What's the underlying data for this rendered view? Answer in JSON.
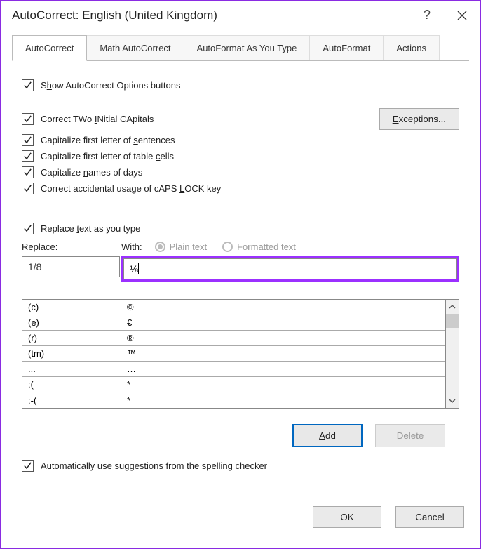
{
  "title": "AutoCorrect: English (United Kingdom)",
  "tabs": [
    "AutoCorrect",
    "Math AutoCorrect",
    "AutoFormat As You Type",
    "AutoFormat",
    "Actions"
  ],
  "active_tab": 0,
  "checks": {
    "show_options": {
      "pre": "S",
      "u": "h",
      "post": "ow AutoCorrect Options buttons"
    },
    "two_initial": {
      "pre": "Correct TWo ",
      "u": "I",
      "post": "Nitial CApitals"
    },
    "sentences": {
      "pre": "Capitalize first letter of ",
      "u": "s",
      "post": "entences"
    },
    "table_cells": {
      "pre": "Capitalize first letter of table ",
      "u": "c",
      "post": "ells"
    },
    "days": {
      "pre": "Capitalize ",
      "u": "n",
      "post": "ames of days"
    },
    "caps_lock": {
      "pre": "Correct accidental usage of cAPS ",
      "u": "L",
      "post": "OCK key"
    },
    "replace_as_type": {
      "pre": "Replace ",
      "u": "t",
      "post": "ext as you type"
    },
    "auto_suggest": {
      "pre": "Automatically use su",
      "u": "g",
      "post": "gestions from the spelling checker"
    }
  },
  "exceptions_btn": {
    "u": "E",
    "post": "xceptions..."
  },
  "replace_label": {
    "u": "R",
    "post": "eplace:"
  },
  "with_label": {
    "u": "W",
    "post": "ith:"
  },
  "radio_plain": "Plain text",
  "radio_formatted": "Formatted text",
  "replace_value": "1/8",
  "with_value": "⅛",
  "table": [
    {
      "a": "(c)",
      "b": "©"
    },
    {
      "a": "(e)",
      "b": "€"
    },
    {
      "a": "(r)",
      "b": "®"
    },
    {
      "a": "(tm)",
      "b": "™"
    },
    {
      "a": "...",
      "b": "…"
    },
    {
      "a": ":(",
      "b": "*"
    },
    {
      "a": ":-(",
      "b": "*"
    }
  ],
  "add_btn": {
    "u": "A",
    "post": "dd"
  },
  "delete_btn": "Delete",
  "ok_btn": "OK",
  "cancel_btn": "Cancel"
}
